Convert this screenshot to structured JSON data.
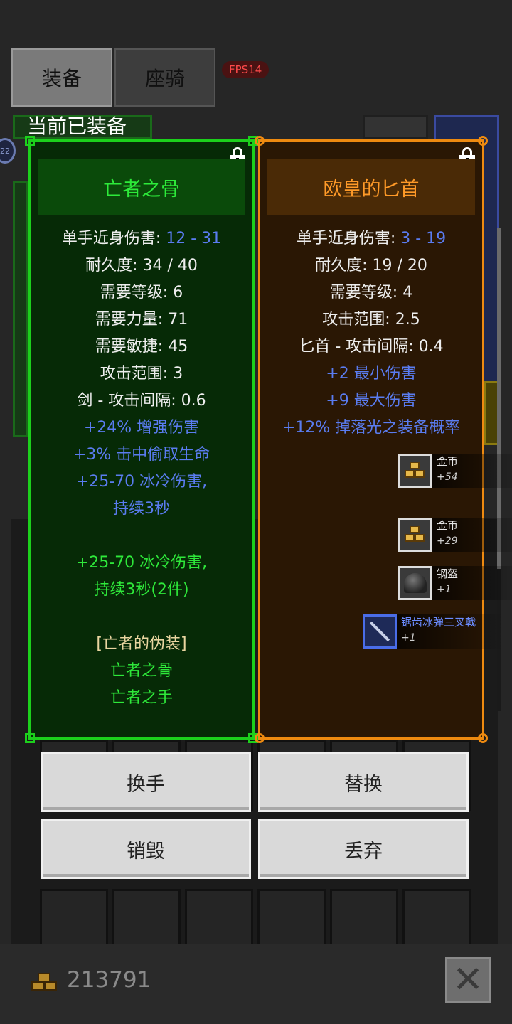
{
  "tabs": [
    {
      "label": "装备",
      "active": true
    },
    {
      "label": "座骑",
      "active": false
    }
  ],
  "fps": "FPS14",
  "section_title": "当前已装备",
  "side_badge": "22",
  "cards": [
    {
      "name": "亡者之骨",
      "rarity": "set",
      "color": "#1cd01c",
      "stats": [
        {
          "label": "单手近身伤害: ",
          "value": "12 - 31"
        },
        {
          "text": "耐久度: 34 / 40"
        },
        {
          "text": "需要等级: 6"
        },
        {
          "text": "需要力量: 71"
        },
        {
          "text": "需要敏捷: 45"
        },
        {
          "text": "攻击范围: 3"
        },
        {
          "text": "剑 - 攻击间隔: 0.6"
        }
      ],
      "magic": [
        "+24% 增强伤害",
        "+3% 击中偷取生命",
        "+25-70 冰冷伤害,",
        "持续3秒"
      ],
      "set_bonus": [
        "+25-70 冰冷伤害,",
        "持续3秒(2件)"
      ],
      "set_name": "[亡者的伪装]",
      "set_items": [
        "亡者之骨",
        "亡者之手"
      ]
    },
    {
      "name": "欧皇的匕首",
      "rarity": "unique",
      "color": "#ee8a10",
      "stats": [
        {
          "label": "单手近身伤害: ",
          "value": "3 - 19"
        },
        {
          "text": "耐久度: 19 / 20"
        },
        {
          "text": "需要等级: 4"
        },
        {
          "text": "攻击范围: 2.5"
        },
        {
          "text": "匕首 - 攻击间隔: 0.4"
        }
      ],
      "magic": [
        "+2 最小伤害",
        "+9 最大伤害",
        "+12% 掉落光之装备概率"
      ]
    }
  ],
  "loot": [
    {
      "name": "金币",
      "qty": "+54",
      "icon": "gold-coins-icon"
    },
    {
      "name": "金币",
      "qty": "+29",
      "icon": "gold-coins-icon"
    },
    {
      "name": "钢盔",
      "qty": "+1",
      "icon": "helmet-icon"
    },
    {
      "name": "锯齿冰弹三叉戟",
      "qty": "+1",
      "icon": "trident-icon"
    }
  ],
  "actions": {
    "swap_hand": "换手",
    "replace": "替换",
    "destroy": "销毁",
    "discard": "丢弃"
  },
  "gold": "213791",
  "close_label": "✕"
}
